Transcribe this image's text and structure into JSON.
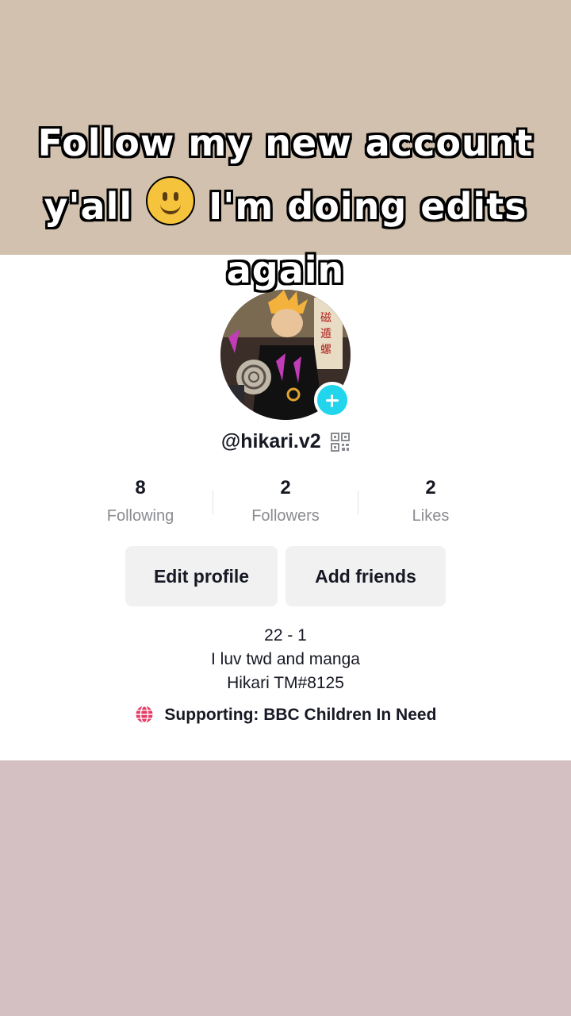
{
  "caption": {
    "line1": "Follow my new account",
    "line2_before": "y'all",
    "emoji": "slightly-smiling-face-icon",
    "line2_after": "I'm doing edits",
    "line3": "again"
  },
  "profile": {
    "username": "@hikari.v2",
    "stats": [
      {
        "value": "8",
        "label": "Following"
      },
      {
        "value": "2",
        "label": "Followers"
      },
      {
        "value": "2",
        "label": "Likes"
      }
    ],
    "buttons": {
      "edit_profile": "Edit profile",
      "add_friends": "Add friends"
    },
    "bio": [
      "22 - 1",
      "I luv twd and manga",
      "Hikari TM#8125"
    ],
    "supporting": "Supporting: BBC Children In Need"
  },
  "colors": {
    "top_band": "#d2c1ae",
    "bottom_band": "#d4bfc2",
    "plus_accent": "#20d5ec",
    "support_icon": "#e33b64"
  }
}
